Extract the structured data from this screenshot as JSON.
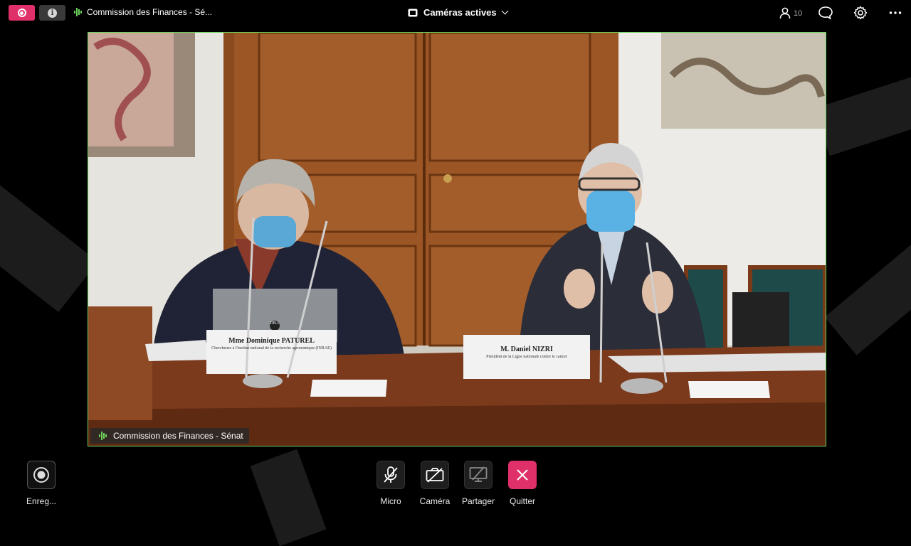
{
  "topbar": {
    "meeting_title": "Commission des Finances - Sé...",
    "cameras_label": "Caméras actives",
    "participant_count": "10"
  },
  "video": {
    "speaker_tag": "Commission des Finances - Sénat",
    "placard_left_name": "Mme Dominique PATUREL",
    "placard_left_sub": "Chercheuse à l'institut national de la recherche agronomique (INRAE)",
    "placard_right_name": "M. Daniel NIZRI",
    "placard_right_sub": "Président de la Ligue nationale contre le cancer",
    "laptop_brand": "DELL"
  },
  "controls": {
    "record_label": "Enreg...",
    "mic_label": "Micro",
    "camera_label": "Caméra",
    "share_label": "Partager",
    "quit_label": "Quitter"
  },
  "colors": {
    "accent": "#e0306a",
    "active_speaker": "#6bd35a"
  }
}
